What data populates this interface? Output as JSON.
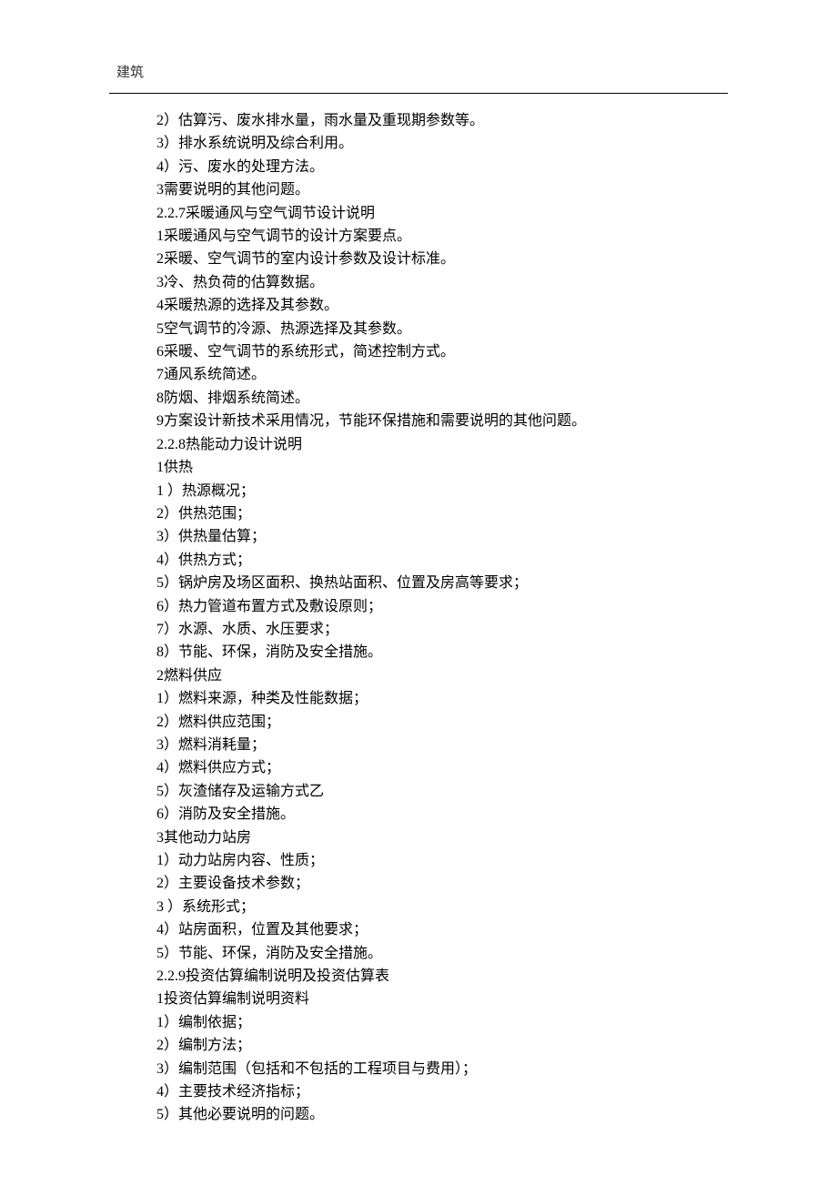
{
  "header": {
    "label": "建筑"
  },
  "lines": [
    "2）估算污、废水排水量，雨水量及重现期参数等。",
    "3）排水系统说明及综合利用。",
    "4）污、废水的处理方法。",
    "3需要说明的其他问题。",
    "2.2.7采暖通风与空气调节设计说明",
    "1采暖通风与空气调节的设计方案要点。",
    "2采暖、空气调节的室内设计参数及设计标准。",
    "3冷、热负荷的估算数据。",
    "4采暖热源的选择及其参数。",
    "5空气调节的冷源、热源选择及其参数。",
    "6采暖、空气调节的系统形式，简述控制方式。",
    "7通风系统简述。",
    "8防烟、排烟系统简述。",
    "9方案设计新技术采用情况，节能环保措施和需要说明的其他问题。",
    "2.2.8热能动力设计说明",
    "1供热",
    "1 ）热源概况；",
    "2）供热范围；",
    "3）供热量估算；",
    "4）供热方式；",
    "5）锅炉房及场区面积、换热站面积、位置及房高等要求；",
    "6）热力管道布置方式及敷设原则；",
    "7）水源、水质、水压要求；",
    "8）节能、环保，消防及安全措施。",
    "2燃料供应",
    "1）燃料来源，种类及性能数据；",
    "2）燃料供应范围；",
    "3）燃料消耗量；",
    "4）燃料供应方式；",
    "5）灰渣储存及运输方式乙",
    "6）消防及安全措施。",
    "3其他动力站房",
    "1）动力站房内容、性质；",
    "2）主要设备技术参数；",
    "3 ）系统形式；",
    "4）站房面积，位置及其他要求；",
    "5）节能、环保，消防及安全措施。",
    "2.2.9投资估算编制说明及投资估算表",
    "1投资估算编制说明资料",
    "1）编制依据；",
    "2）编制方法；",
    "3）编制范围（包括和不包括的工程项目与费用）；",
    "4）主要技术经济指标；",
    "5）其他必要说明的问题。"
  ]
}
